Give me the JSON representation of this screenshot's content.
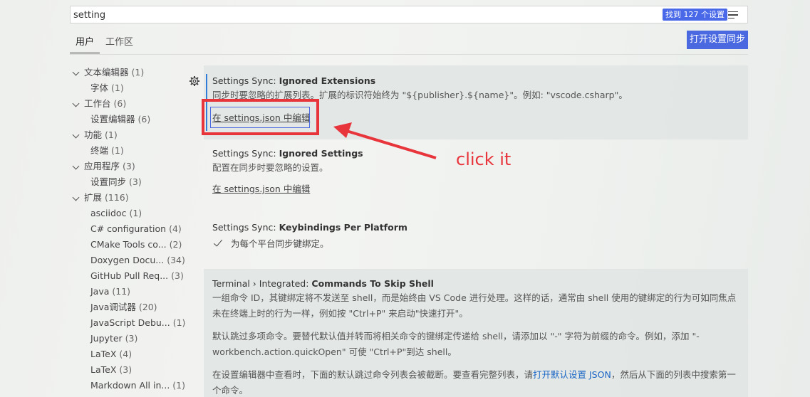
{
  "search": {
    "value": "setting",
    "result_count": "找到 127 个设置"
  },
  "tabs": [
    {
      "label": "用户",
      "active": true
    },
    {
      "label": "工作区",
      "active": false
    }
  ],
  "sync_button": "打开设置同步",
  "tree": [
    {
      "label": "文本编辑器",
      "count": "(1)",
      "level": 0
    },
    {
      "label": "字体",
      "count": "(1)",
      "level": 1
    },
    {
      "label": "工作台",
      "count": "(6)",
      "level": 0
    },
    {
      "label": "设置编辑器",
      "count": "(6)",
      "level": 1
    },
    {
      "label": "功能",
      "count": "(1)",
      "level": 0
    },
    {
      "label": "终端",
      "count": "(1)",
      "level": 1
    },
    {
      "label": "应用程序",
      "count": "(3)",
      "level": 0
    },
    {
      "label": "设置同步",
      "count": "(3)",
      "level": 1
    },
    {
      "label": "扩展",
      "count": "(116)",
      "level": 0
    },
    {
      "label": "asciidoc",
      "count": "(1)",
      "level": 1
    },
    {
      "label": "C# configuration",
      "count": "(4)",
      "level": 1
    },
    {
      "label": "CMake Tools co...",
      "count": "(2)",
      "level": 1
    },
    {
      "label": "Doxygen Docu...",
      "count": "(34)",
      "level": 1
    },
    {
      "label": "GitHub Pull Req...",
      "count": "(3)",
      "level": 1
    },
    {
      "label": "Java",
      "count": "(11)",
      "level": 1
    },
    {
      "label": "Java调试器",
      "count": "(20)",
      "level": 1
    },
    {
      "label": "JavaScript Debu...",
      "count": "(1)",
      "level": 1
    },
    {
      "label": "Jupyter",
      "count": "(3)",
      "level": 1
    },
    {
      "label": "LaTeX",
      "count": "(4)",
      "level": 1
    },
    {
      "label": "LaTeX",
      "count": "(3)",
      "level": 1
    },
    {
      "label": "Markdown All in...",
      "count": "(1)",
      "level": 1
    }
  ],
  "settings": {
    "ignored_ext": {
      "category": "Settings Sync: ",
      "name": "Ignored Extensions",
      "desc": "同步时要忽略的扩展列表。扩展的标识符始终为 \"${publisher}.${name}\"。例如: \"vscode.csharp\"。",
      "link": "在 settings.json 中编辑"
    },
    "ignored_settings": {
      "category": "Settings Sync: ",
      "name": "Ignored Settings",
      "desc": "配置在同步时要忽略的设置。",
      "link": "在 settings.json 中编辑"
    },
    "keybindings": {
      "category": "Settings Sync: ",
      "name": "Keybindings Per Platform",
      "checkbox_label": "为每个平台同步键绑定。",
      "checked": true
    },
    "terminal": {
      "category": "Terminal › Integrated: ",
      "name": "Commands To Skip Shell",
      "desc1": "一组命令 ID，其键绑定将不发送至 shell，而是始终由 VS Code 进行处理。这样的话，通常由 shell 使用的键绑定的行为可如同焦点未在终端上时的行为一样，例如按 \"Ctrl+P\" 来启动\"快速打开\"。",
      "desc2": "默认跳过多项命令。要替代默认值并转而将相关命令的键绑定传递给 shell，请添加以 \"-\" 字符为前缀的命令。例如，添加 \"-workbench.action.quickOpen\" 可使 \"Ctrl+P\"到达 shell。",
      "desc3_pre": "在设置编辑器中查看时，下面的默认跳过命令列表会被截断。要查看完整列表，请",
      "desc3_link": "打开默认设置 JSON",
      "desc3_post": "，然后从下面的列表中搜索第一个命令。"
    }
  },
  "annotation": {
    "text": "click it",
    "color": "#e8343b"
  },
  "colors": {
    "accent": "#4a68e0",
    "focus": "#2e7dd8",
    "link": "#1a66c5"
  }
}
